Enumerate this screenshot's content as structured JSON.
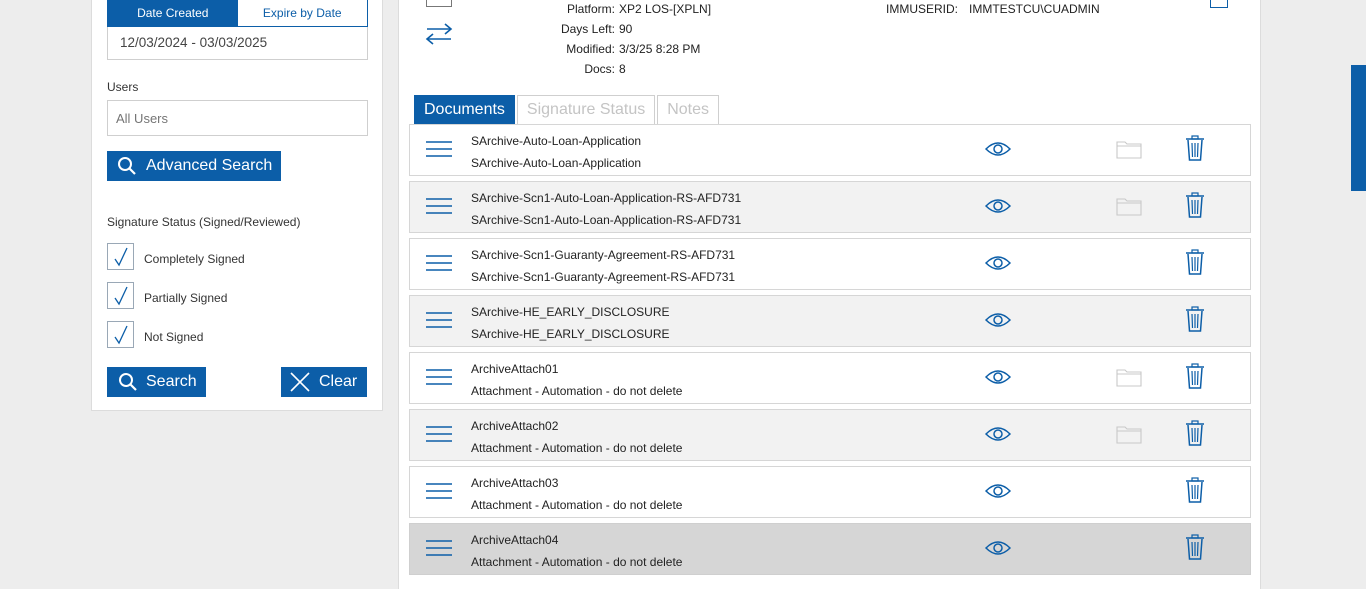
{
  "filters": {
    "date_tabs": [
      "Date Created",
      "Expire by Date"
    ],
    "date_range": "12/03/2024 - 03/03/2025",
    "users_label": "Users",
    "users_placeholder": "All Users",
    "advanced_search_label": "Advanced Search",
    "signature_status_label": "Signature Status (Signed/Reviewed)",
    "checkboxes": [
      {
        "label": "Completely Signed",
        "checked": true
      },
      {
        "label": "Partially Signed",
        "checked": true
      },
      {
        "label": "Not Signed",
        "checked": true
      }
    ],
    "search_label": "Search",
    "clear_label": "Clear"
  },
  "package_meta": {
    "platform_label": "Platform:",
    "platform_value": "XP2 LOS-[XPLN]",
    "days_left_label": "Days Left:",
    "days_left_value": "90",
    "modified_label": "Modified:",
    "modified_value": "3/3/25 8:28 PM",
    "docs_label": "Docs:",
    "docs_value": "8",
    "immuserid_label": "IMMUSERID:",
    "immuserid_value": "IMMTESTCU\\CUADMIN"
  },
  "tabs": [
    "Documents",
    "Signature Status",
    "Notes"
  ],
  "documents": [
    {
      "name": "SArchive-Auto-Loan-Application",
      "desc": "SArchive-Auto-Loan-Application",
      "folder": true
    },
    {
      "name": "SArchive-Scn1-Auto-Loan-Application-RS-AFD731",
      "desc": "SArchive-Scn1-Auto-Loan-Application-RS-AFD731",
      "folder": true
    },
    {
      "name": "SArchive-Scn1-Guaranty-Agreement-RS-AFD731",
      "desc": "SArchive-Scn1-Guaranty-Agreement-RS-AFD731",
      "folder": false
    },
    {
      "name": "SArchive-HE_EARLY_DISCLOSURE",
      "desc": "SArchive-HE_EARLY_DISCLOSURE",
      "folder": false
    },
    {
      "name": "ArchiveAttach01",
      "desc": "Attachment - Automation - do not delete",
      "folder": true
    },
    {
      "name": "ArchiveAttach02",
      "desc": "Attachment - Automation - do not delete",
      "folder": true
    },
    {
      "name": "ArchiveAttach03",
      "desc": "Attachment - Automation - do not delete",
      "folder": false
    },
    {
      "name": "ArchiveAttach04",
      "desc": "Attachment - Automation - do not delete",
      "folder": false
    }
  ],
  "colors": {
    "accent": "#0c5ea8",
    "row_alt": "#f2f2f2",
    "row_selected": "#d6d6d6"
  }
}
